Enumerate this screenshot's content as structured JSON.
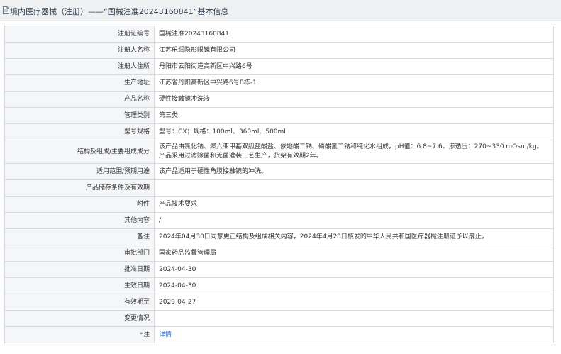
{
  "header": {
    "title": "境内医疗器械（注册）——“国械注准20243160841”基本信息"
  },
  "rows": [
    {
      "label": "注册证编号",
      "value": "国械注准20243160841"
    },
    {
      "label": "注册人名称",
      "value": "江苏乐润隐形眼镜有限公司"
    },
    {
      "label": "注册人住所",
      "value": "丹阳市云阳街道高新区中兴路6号"
    },
    {
      "label": "生产地址",
      "value": "江苏省丹阳高新区中兴路6号B栋-1"
    },
    {
      "label": "产品名称",
      "value": "硬性接触镜冲洗液"
    },
    {
      "label": "管理类别",
      "value": "第三类"
    },
    {
      "label": "型号规格",
      "value": "型号：CX；规格：100ml、360ml、500ml"
    },
    {
      "label": "结构及组成/主要组成成分",
      "value": "该产品由氯化钠、聚六亚甲基双胍盐酸盐、依地酸二钠、磷酸氢二钠和纯化水组成。pH值：6.8~7.6。渗透压：270~330 mOsm/kg。产品采用过滤除菌和无菌灌装工艺生产，货架有效期2年。"
    },
    {
      "label": "适用范围/预期用途",
      "value": "该产品适用于硬性角膜接触镜的冲洗。"
    },
    {
      "label": "产品储存条件及有效期",
      "value": ""
    },
    {
      "label": "附件",
      "value": "产品技术要求"
    },
    {
      "label": "其他内容",
      "value": "/"
    },
    {
      "label": "备注",
      "value": "2024年04月30日同意更正结构及组成相关内容，2024年4月28日核发的中华人民共和国医疗器械注册证予以废止。"
    },
    {
      "label": "审批部门",
      "value": "国家药品监督管理局"
    },
    {
      "label": "批准日期",
      "value": "2024-04-30"
    },
    {
      "label": "生效日期",
      "value": "2024-04-30"
    },
    {
      "label": "有效期至",
      "value": "2029-04-27"
    },
    {
      "label": "变更情况",
      "value": ""
    },
    {
      "label": "注",
      "value": "详情",
      "star": "*"
    }
  ],
  "colors": {
    "header_bg": "#eef0f2",
    "label_bg": "#f5f6f8",
    "border": "#d7dbe0",
    "link": "#2b6cc4"
  }
}
